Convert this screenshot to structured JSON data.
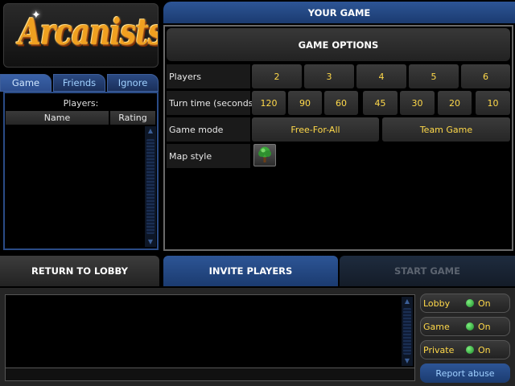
{
  "logo": {
    "text": "Arcanists"
  },
  "left_tabs": [
    {
      "label": "Game"
    },
    {
      "label": "Friends"
    },
    {
      "label": "Ignore"
    }
  ],
  "players_list": {
    "caption": "Players:",
    "columns": [
      "Name",
      "Rating"
    ]
  },
  "your_game": {
    "title": "YOUR GAME"
  },
  "game_options": {
    "title": "GAME OPTIONS",
    "players": {
      "label": "Players",
      "options": [
        "2",
        "3",
        "4",
        "5",
        "6"
      ]
    },
    "turn_time": {
      "label": "Turn time (seconds)",
      "options": [
        "120",
        "90",
        "60",
        "45",
        "30",
        "20",
        "10"
      ]
    },
    "game_mode": {
      "label": "Game mode",
      "options": [
        "Free-For-All",
        "Team Game"
      ]
    },
    "map_style": {
      "label": "Map style",
      "icon": "tree-icon"
    }
  },
  "buttons": {
    "return_to_lobby": "RETURN TO LOBBY",
    "invite_players": "INVITE PLAYERS",
    "start_game": "START GAME"
  },
  "chat_channels": [
    {
      "label": "Lobby",
      "state": "On"
    },
    {
      "label": "Game",
      "state": "On"
    },
    {
      "label": "Private",
      "state": "On"
    }
  ],
  "report_abuse": "Report abuse",
  "colors": {
    "accent_blue": "#2d5596",
    "option_text": "#ffd94a",
    "status_on": "#3cc04a"
  }
}
